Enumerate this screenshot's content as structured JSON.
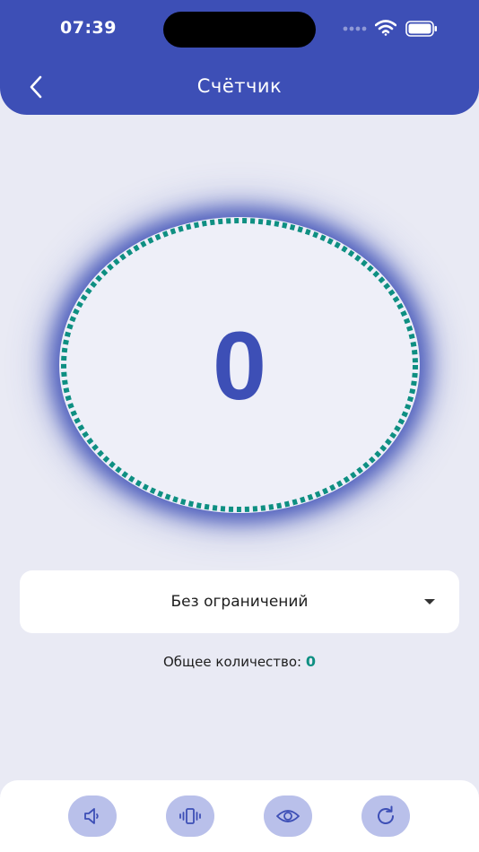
{
  "status_bar": {
    "time": "07:39"
  },
  "header": {
    "title": "Счётчик"
  },
  "counter": {
    "value": "0"
  },
  "limit_select": {
    "selected": "Без ограничений"
  },
  "total": {
    "label": "Общее количество:",
    "value": "0"
  },
  "toolbar": {
    "buttons": [
      {
        "icon": "sound-icon"
      },
      {
        "icon": "vibration-icon"
      },
      {
        "icon": "eye-icon"
      },
      {
        "icon": "reset-icon"
      }
    ]
  },
  "colors": {
    "primary": "#3d4fb6",
    "accent": "#0e8f82",
    "background": "#e9eaf4",
    "button_bg": "#b9c0ea"
  }
}
